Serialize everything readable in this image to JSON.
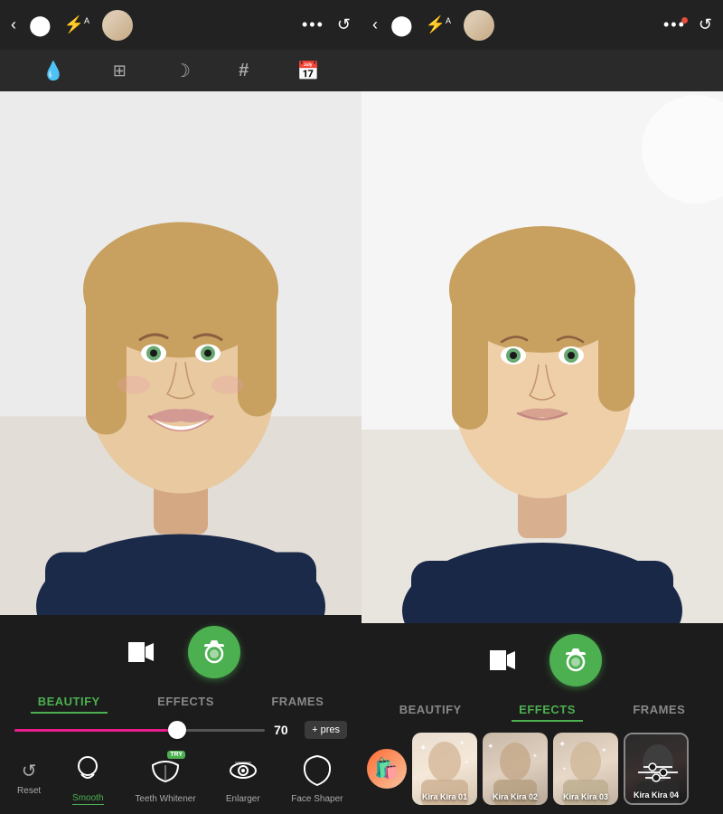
{
  "panels": {
    "left": {
      "activeTab": "BEAUTIFY",
      "tabs": [
        "BEAUTIFY",
        "EFFECTS",
        "FRAMES"
      ],
      "slider": {
        "value": "70",
        "fill_percent": 65
      },
      "preset_label": "+ pres",
      "tools": [
        {
          "id": "reset",
          "label": "Reset",
          "icon": "↺",
          "isReset": true
        },
        {
          "id": "smooth",
          "label": "Smooth",
          "icon": "face",
          "active": true
        },
        {
          "id": "teeth",
          "label": "Teeth Whitener",
          "icon": "lips",
          "hasTry": true
        },
        {
          "id": "enlarger",
          "label": "Enlarger",
          "icon": "eye",
          "hasTry": false
        },
        {
          "id": "faceshaper",
          "label": "Face Shaper",
          "icon": "faceoval",
          "hasTry": false
        }
      ]
    },
    "right": {
      "activeTab": "EFFECTS",
      "tabs": [
        "BEAUTIFY",
        "EFFECTS",
        "FRAMES"
      ],
      "effects": [
        {
          "id": "kira1",
          "label": "Kira Kira 01",
          "bg": "kira1"
        },
        {
          "id": "kira2",
          "label": "Kira Kira 02",
          "bg": "kira2"
        },
        {
          "id": "kira3",
          "label": "Kira Kira 03",
          "bg": "kira3"
        },
        {
          "id": "kira4",
          "label": "Kira Kira 04",
          "bg": "kira4",
          "selected": true
        }
      ]
    }
  },
  "icons": {
    "back": "‹",
    "capture_circle": "◉",
    "flash": "⚡",
    "flash_sub": "A",
    "more": "•••",
    "undo": "↺",
    "water": "💧",
    "expand": "⤢",
    "moon": "☽",
    "hash": "#",
    "calendar": "📅",
    "video": "▶",
    "camera": "📷",
    "shop": "🛍️"
  },
  "colors": {
    "active_tab": "#4caf50",
    "capture_btn": "#4caf50",
    "slider_color": "#e91e8c",
    "active_tool_label": "#4caf50"
  }
}
